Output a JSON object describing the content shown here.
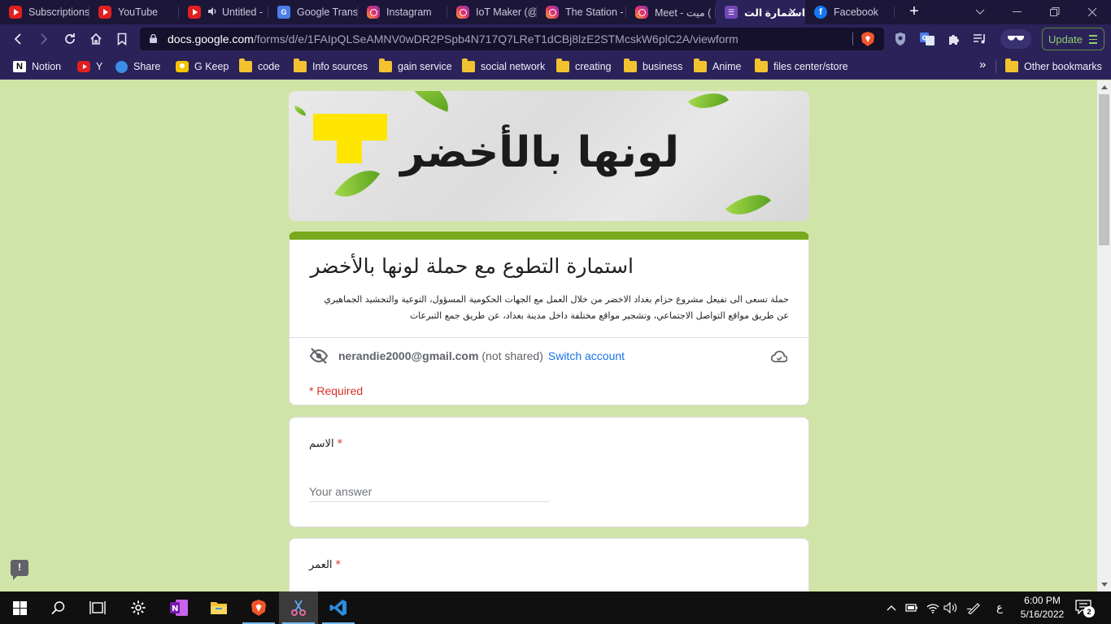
{
  "tabs": [
    {
      "title": "Subscriptions",
      "icon": "youtube-icon"
    },
    {
      "title": "YouTube",
      "icon": "youtube-icon"
    },
    {
      "title": "Untitled -",
      "icon": "youtube-icon"
    },
    {
      "title": "Google Transl",
      "icon": "google-translate-icon"
    },
    {
      "title": "Instagram",
      "icon": "instagram-icon"
    },
    {
      "title": "IoT Maker (@",
      "icon": "instagram-icon"
    },
    {
      "title": "The Station -",
      "icon": "instagram-icon"
    },
    {
      "title": "Meet - ميت (",
      "icon": "instagram-icon"
    },
    {
      "title": "استمارة الت",
      "icon": "google-forms-icon"
    },
    {
      "title": "Facebook",
      "icon": "facebook-icon"
    }
  ],
  "address_bar": {
    "domain": "docs.google.com",
    "path": "/forms/d/e/1FAIpQLSeAMNV0wDR2PSpb4N717Q7LReT1dCBj8lzE2STMcskW6plC2A/viewform"
  },
  "update_label": "Update",
  "bookmarks": [
    {
      "label": "Notion",
      "icon": "notion-icon"
    },
    {
      "label": "Y",
      "icon": "youtube-icon"
    },
    {
      "label": "Share",
      "icon": "share-icon"
    },
    {
      "label": "G Keep",
      "icon": "google-keep-icon"
    },
    {
      "label": "code",
      "icon": "folder-icon"
    },
    {
      "label": "Info sources",
      "icon": "folder-icon"
    },
    {
      "label": "gain service",
      "icon": "folder-icon"
    },
    {
      "label": "social network",
      "icon": "folder-icon"
    },
    {
      "label": "creating",
      "icon": "folder-icon"
    },
    {
      "label": "business",
      "icon": "folder-icon"
    },
    {
      "label": "Anime",
      "icon": "folder-icon"
    },
    {
      "label": "files center/store",
      "icon": "folder-icon"
    }
  ],
  "bookmarks_more": "»",
  "other_bookmarks": "Other bookmarks",
  "form": {
    "banner_title": "لونها بالأخضر",
    "title": "استمارة التطوع مع حملة لونها بالأخضر",
    "description_line1": "حملة تسعى الى تفيعل مشروع حزام بغداد الاخضر من خلال العمل مع الجهات الحكومية المسؤول، التوعية والتحشيد الجماهيري",
    "description_line2": "عن طريق مواقع التواصل الاجتماعي، وتشجير مواقع مختلفة داخل مدينة بغداد، عن طريق جمع التبرعات",
    "account_email": "nerandie2000@gmail.com",
    "not_shared": "(not shared)",
    "switch_account": "Switch account",
    "required_note": "* Required",
    "questions": [
      {
        "label": "الاسم",
        "required_mark": "*",
        "placeholder": "Your answer"
      },
      {
        "label": "العمر",
        "required_mark": "*"
      }
    ]
  },
  "feedback_label": "!",
  "taskbar": {
    "time": "6:00 PM",
    "date": "5/16/2022",
    "language": "ع",
    "notification_count": "2"
  },
  "colors": {
    "page_background": "#d1e4a7",
    "form_accent": "#78a91c",
    "required": "#d93025",
    "link": "#1a73e8",
    "browser_chrome": "#2b2259"
  }
}
